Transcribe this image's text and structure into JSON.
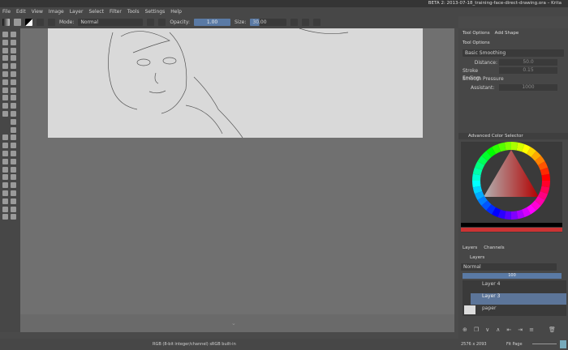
{
  "window": {
    "title": "BETA 2: 2013-07-18_training-face-direct-drawing.ora – Krita"
  },
  "menu": [
    "File",
    "Edit",
    "View",
    "Image",
    "Layer",
    "Select",
    "Filter",
    "Tools",
    "Settings",
    "Help"
  ],
  "toolbar": {
    "mode_label": "Mode:",
    "mode_value": "Normal",
    "opacity_label": "Opacity:",
    "opacity_value": "1.00",
    "size_label": "Size:",
    "size_value": "30.00"
  },
  "tool_options": {
    "tabs": [
      "Tool Options",
      "Add Shape"
    ],
    "title": "Tool Options",
    "smoothing": "Basic Smoothing",
    "distance_label": "Distance:",
    "distance_value": "50.0",
    "stroke_ending_label": "Stroke Ending:",
    "stroke_ending_value": "0.15",
    "smooth_pressure_label": "Smooth Pressure",
    "assistant_label": "Assistant:",
    "assistant_value": "1000"
  },
  "color_selector": {
    "title": "Advanced Color Selector",
    "hue": "#ff0000"
  },
  "layers": {
    "tabs": [
      "Layers",
      "Channels"
    ],
    "title": "Layers",
    "blend_mode": "Normal",
    "opacity": "100",
    "items": [
      {
        "name": "Layer 4",
        "selected": false
      },
      {
        "name": "Layer 3",
        "selected": true
      },
      {
        "name": "paper",
        "selected": false
      }
    ]
  },
  "status": {
    "color_profile": "RGB (8-bit integer/channel)  sRGB built-in",
    "dimensions": "2576 x 2093",
    "zoom_mode": "Fit Page"
  }
}
